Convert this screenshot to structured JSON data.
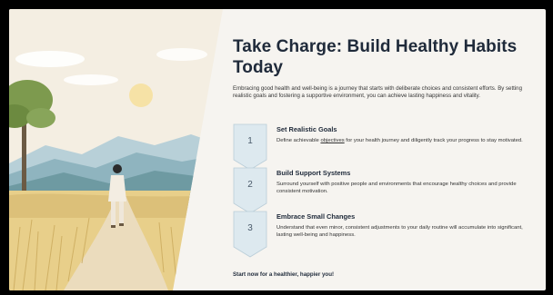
{
  "slide": {
    "title_line1": "Take Charge: Build Healthy Habits",
    "title_line2": "Today",
    "intro": "Embracing good health and well-being is a journey that starts with deliberate choices and consistent efforts. By setting realistic goals and fostering a supportive environment, you can achieve lasting happiness and vitality.",
    "steps": [
      {
        "number": "1",
        "title": "Set Realistic Goals",
        "desc_before": "Define achievable ",
        "desc_link": "objectives",
        "desc_after": " for your health journey and diligently track your progress to stay motivated."
      },
      {
        "number": "2",
        "title": "Build Support Systems",
        "desc": "Surround yourself with positive people and environments that encourage healthy choices and provide consistent motivation."
      },
      {
        "number": "3",
        "title": "Embrace Small Changes",
        "desc": "Understand that even minor, consistent adjustments to your daily routine will accumulate into significant, lasting well-being and happiness."
      }
    ],
    "cta": "Start now for a healthier, happier you!"
  },
  "colors": {
    "background": "#f6f4f0",
    "heading": "#1f2a3a",
    "step_arrow": "#dde9ef",
    "step_arrow_border": "#b9cdd8"
  },
  "illustration": {
    "subject": "woman-walking-on-path-illustration"
  }
}
